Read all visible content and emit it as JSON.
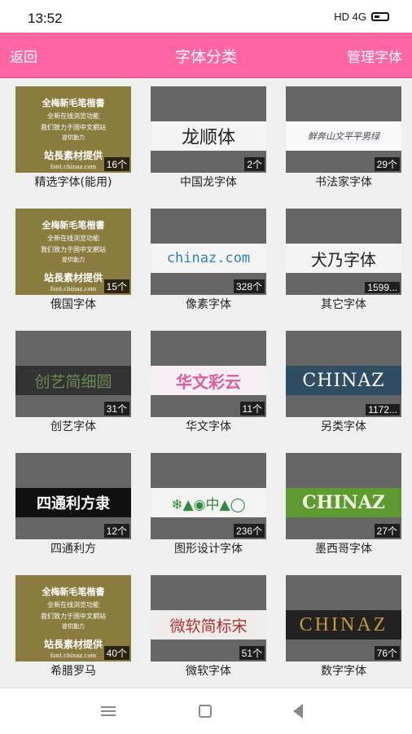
{
  "status": {
    "time": "13:52",
    "icons": "HD 4G"
  },
  "header": {
    "back": "返回",
    "title": "字体分类",
    "manage": "管理字体"
  },
  "calligraphy": {
    "l1": "全梅新毛笔楷書",
    "l2": "全新在线浏览功能",
    "l3": "我们致力于国中文網站",
    "l4": "提供動力",
    "l5": "站長素材提供",
    "l6": "font.chinaz.com"
  },
  "items": [
    {
      "label": "精选字体(能用)",
      "count": "16个",
      "preview": ""
    },
    {
      "label": "中国龙字体",
      "count": "2个",
      "preview": "龙顺体"
    },
    {
      "label": "书法家字体",
      "count": "29个",
      "preview": "鲜奔山文平平男绿"
    },
    {
      "label": "俄国字体",
      "count": "15个",
      "preview": ""
    },
    {
      "label": "像素字体",
      "count": "328个",
      "preview": "chinaz.com"
    },
    {
      "label": "其它字体",
      "count": "1599...",
      "preview": "犬乃字体"
    },
    {
      "label": "创艺字体",
      "count": "31个",
      "preview": "创艺简细圆"
    },
    {
      "label": "华文字体",
      "count": "11个",
      "preview": "华文彩云"
    },
    {
      "label": "另类字体",
      "count": "1172...",
      "preview": "CHINAZ"
    },
    {
      "label": "四通利方",
      "count": "12个",
      "preview": "四通利方隶"
    },
    {
      "label": "图形设计字体",
      "count": "236个",
      "preview": "❄▲◉中▲◯"
    },
    {
      "label": "墨西哥字体",
      "count": "27个",
      "preview": "CHINAZ"
    },
    {
      "label": "希腊罗马",
      "count": "40个",
      "preview": ""
    },
    {
      "label": "微软字体",
      "count": "51个",
      "preview": "微软简标宋"
    },
    {
      "label": "数字字体",
      "count": "76个",
      "preview": "CHINAZ"
    }
  ]
}
